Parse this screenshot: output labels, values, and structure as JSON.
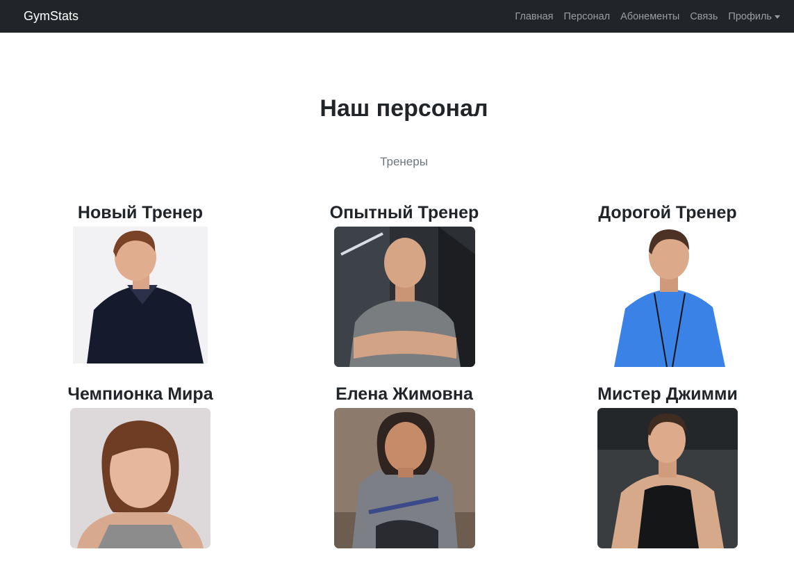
{
  "navbar": {
    "brand": "GymStats",
    "links": [
      {
        "label": "Главная"
      },
      {
        "label": "Персонал"
      },
      {
        "label": "Абонементы"
      },
      {
        "label": "Связь"
      },
      {
        "label": "Профиль"
      }
    ]
  },
  "page": {
    "title": "Наш персонал",
    "subtitle": "Тренеры"
  },
  "trainers": [
    {
      "name": "Новый Тренер"
    },
    {
      "name": "Опытный Тренер"
    },
    {
      "name": "Дорогой Тренер"
    },
    {
      "name": "Чемпионка Мира"
    },
    {
      "name": "Елена Жимовна"
    },
    {
      "name": "Мистер Джимми"
    }
  ]
}
